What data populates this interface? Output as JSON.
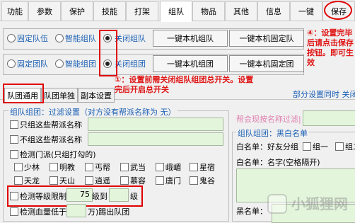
{
  "tabs": [
    "功能",
    "参数",
    "保护",
    "技能",
    "打架",
    "组队",
    "物品",
    "其他",
    "信息",
    "一键",
    "保存"
  ],
  "row1": {
    "opt1": "固定队伍",
    "opt2": "智能组队",
    "opt3": "关闭组队",
    "btn1": "一键本机组队",
    "btn2": "一键本机固定队"
  },
  "row2": {
    "opt1": "固定团队",
    "opt2": "智能组团",
    "opt3": "关闭组团",
    "btn1": "一键本机组团",
    "btn2": "一键本机固定团"
  },
  "note_top": "④：设置完毕后请点击保存按钮。即可生效",
  "note_mid": "①：设置前需关闭组队组团总开关。设置完后开启总开关",
  "subtabs": [
    "队团通用",
    "队团单独",
    "副本设置"
  ],
  "partial_text": "部分设置同时 关闭",
  "filter_title": "组队组团：过滤设置（对方没有帮派名称为 无）",
  "only_guild": "只组这些帮派名称",
  "not_guild": "不组这些帮派名称",
  "check_sect": "检测门派(只组打勾的)",
  "sects": [
    "少林",
    "明教",
    "丐帮",
    "武当",
    "峨嵋",
    "星宿",
    "天龙",
    "天山",
    "逍遥",
    "慕容",
    "唐门",
    "鬼谷"
  ],
  "level_limit": {
    "label": "检测等级限制",
    "min": "75",
    "mid": "级到",
    "max": "",
    "unit": "级"
  },
  "blood_low": {
    "label": "检测血量低于",
    "value": "",
    "suffix": "万)踢出队团"
  },
  "hint_filter": "帮会现按名称过滤|",
  "bw_title": "组队组团：黑白名单",
  "white_label": "白名单：好友分组",
  "group1": "组一",
  "group2": "组二",
  "white_name": "白名单：名字(空格隔开)",
  "black_label": "黑名单：",
  "watermark": "小狐狸网"
}
